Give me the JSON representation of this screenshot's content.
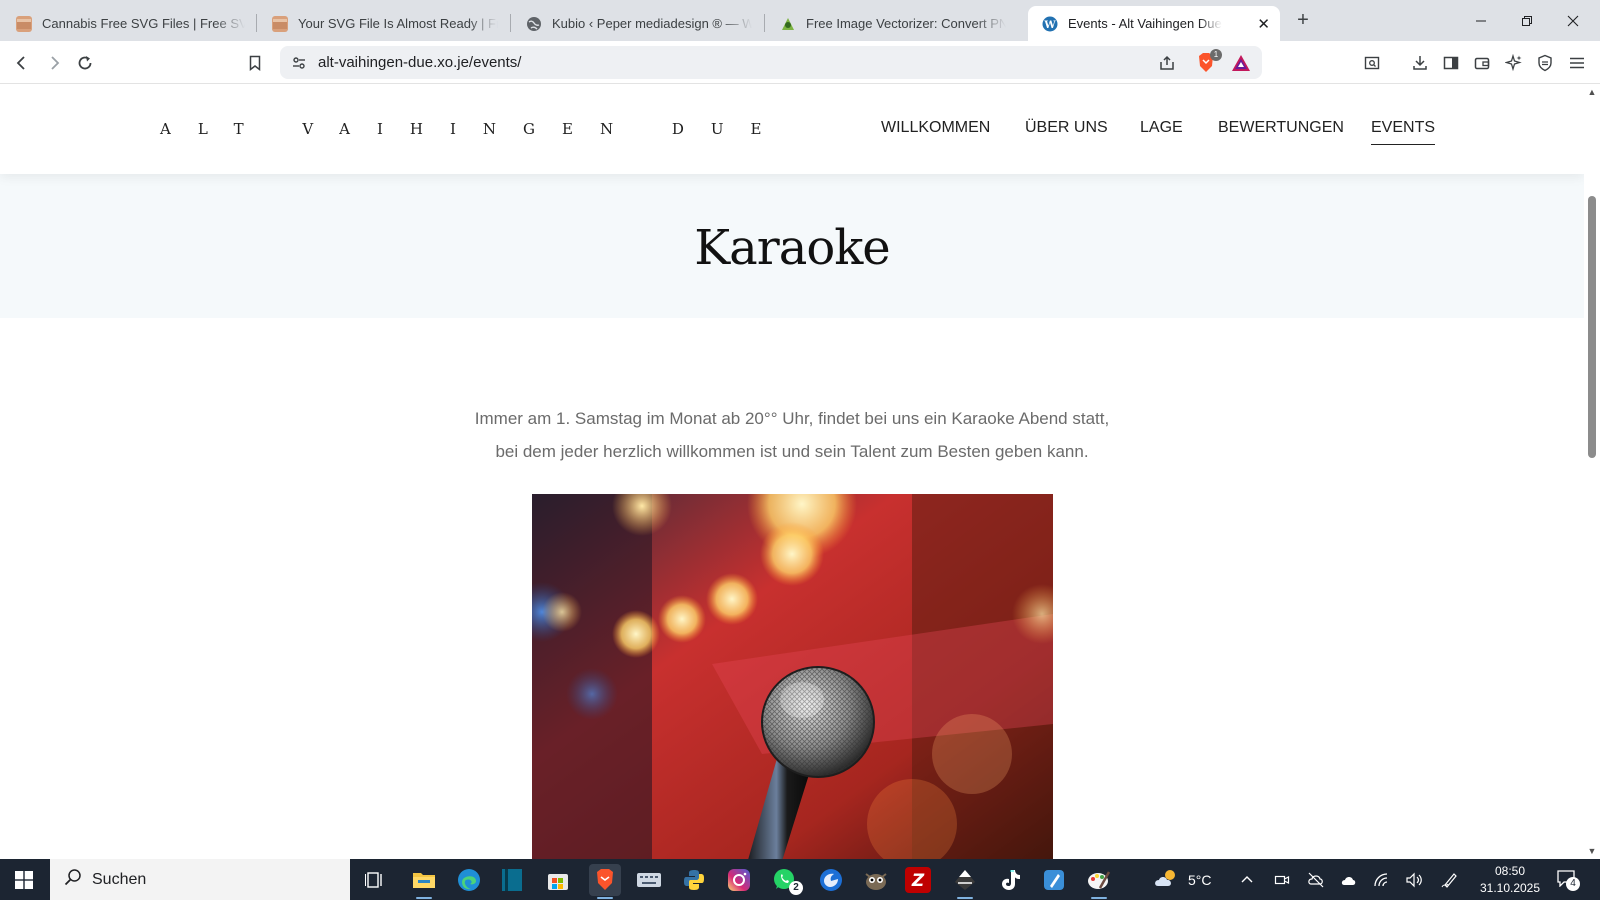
{
  "browser": {
    "tabs": [
      {
        "title": "Cannabis Free SVG Files | Free SVG D",
        "icon": "svg-site-favicon-icon"
      },
      {
        "title": "Your SVG File Is Almost Ready | Free S",
        "icon": "svg-site-favicon-icon"
      },
      {
        "title": "Kubio ‹ Peper mediadesign ® — Wor",
        "icon": "globe-icon"
      },
      {
        "title": "Free Image Vectorizer: Convert PNG t",
        "icon": "vectorizer-favicon-icon"
      },
      {
        "title": "Events - Alt Vaihingen Due",
        "icon": "wordpress-icon",
        "active": true
      }
    ],
    "new_tab_label": "+",
    "url": "alt-vaihingen-due.xo.je/events/",
    "brave_badge": "1"
  },
  "site": {
    "logo": "ALT VAIHINGEN DUE",
    "nav": [
      {
        "label": "WILLKOMMEN"
      },
      {
        "label": "ÜBER UNS"
      },
      {
        "label": "LAGE"
      },
      {
        "label": "BEWERTUNGEN"
      },
      {
        "label": "EVENTS",
        "active": true
      }
    ],
    "hero_title": "Karaoke",
    "intro_line1": "Immer am 1. Samstag im Monat ab 20°° Uhr, findet bei uns ein Karaoke Abend statt,",
    "intro_line2": "bei dem jeder herzlich willkommen ist und sein Talent zum Besten geben kann.",
    "image_subject": "karaoke-microphone-photo"
  },
  "taskbar": {
    "search_placeholder": "Suchen",
    "weather_temp": "5°C",
    "time": "08:50",
    "date": "31.10.2025",
    "whatsapp_badge": "2",
    "notification_count": "4"
  },
  "colors": {
    "tabstrip_bg": "#dee1e6",
    "hero_bg": "#f5f9fb",
    "taskbar_bg": "#1c2532",
    "intro_text": "#6b6b6b"
  }
}
